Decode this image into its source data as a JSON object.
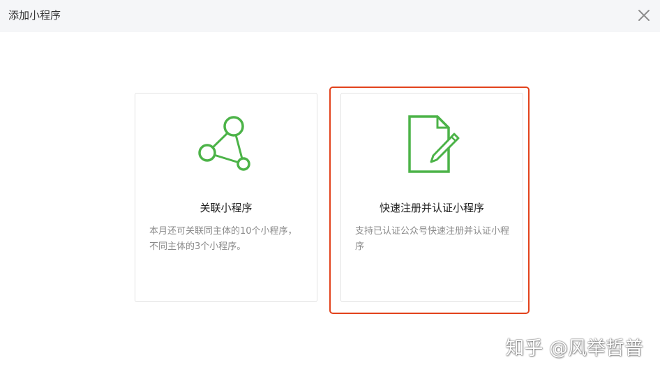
{
  "dialog": {
    "title": "添加小程序",
    "close_icon": "close-icon"
  },
  "options": [
    {
      "icon": "network-nodes-icon",
      "title": "关联小程序",
      "description": "本月还可关联同主体的10个小程序，不同主体的3个小程序。"
    },
    {
      "icon": "document-edit-icon",
      "title": "快速注册并认证小程序",
      "description": "支持已认证公众号快速注册并认证小程序"
    }
  ],
  "colors": {
    "accent_green": "#4cb348",
    "highlight_red": "#e2421c",
    "header_bg": "#f5f6f8"
  },
  "watermark": "知乎 @风举哲普"
}
